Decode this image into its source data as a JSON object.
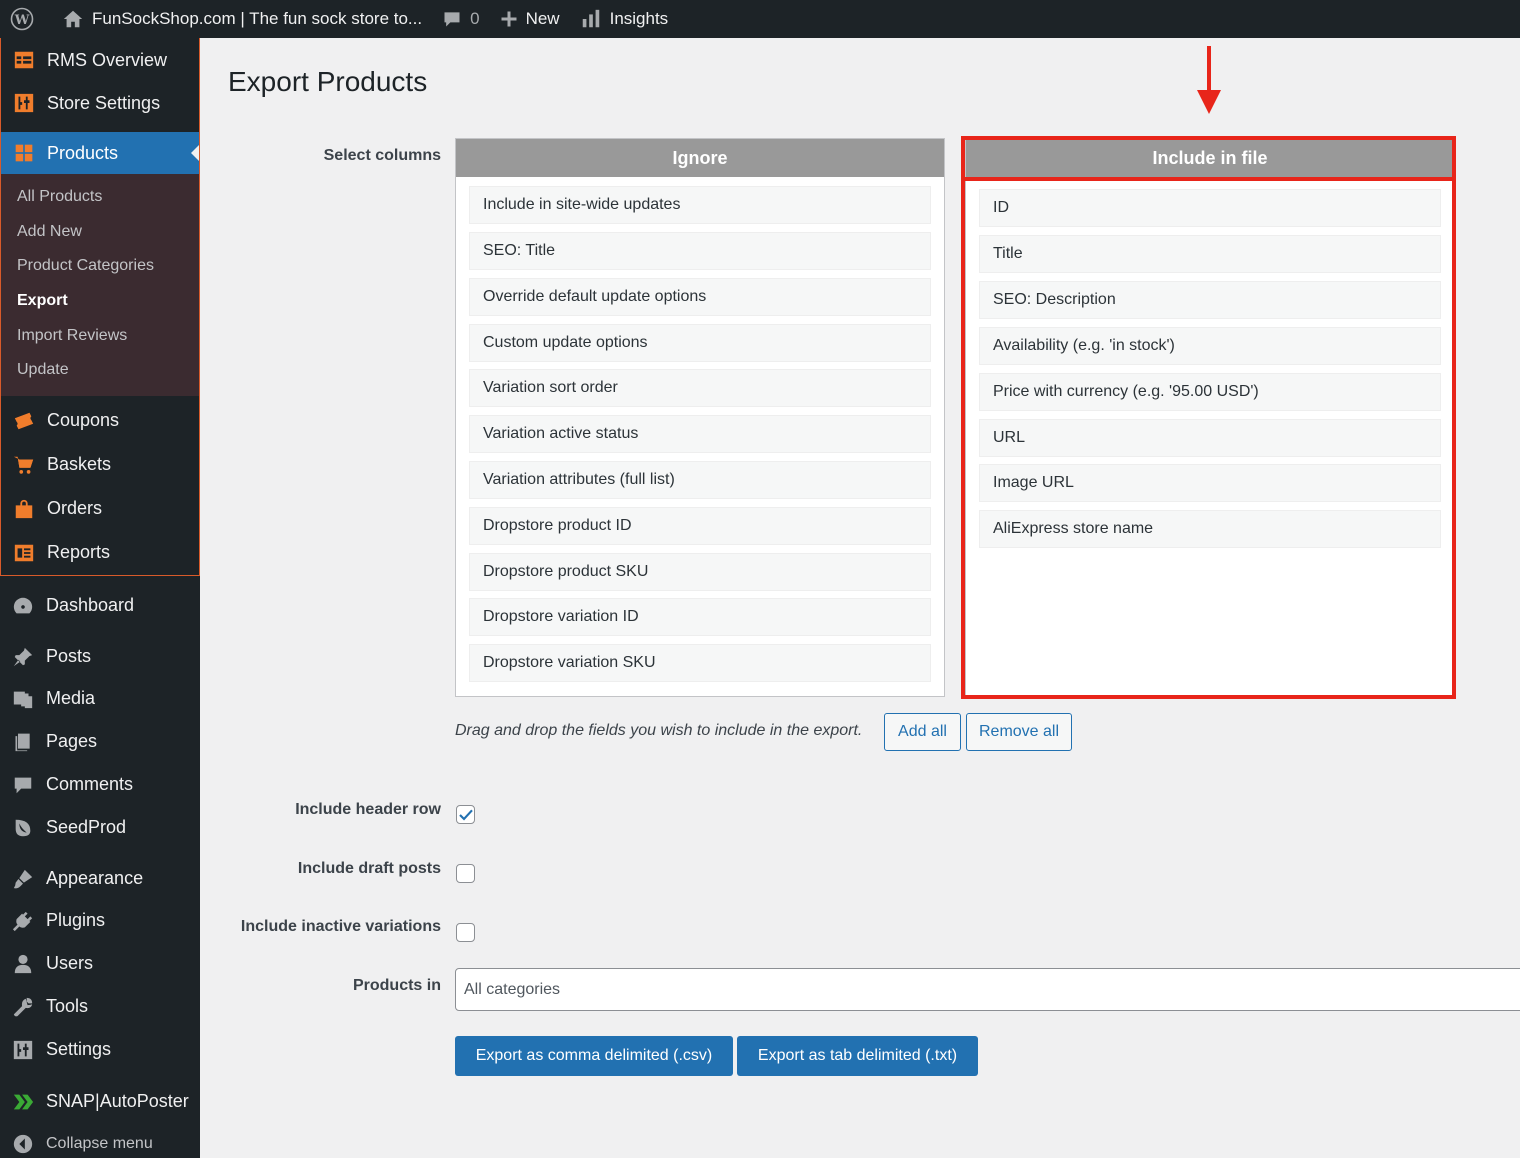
{
  "adminbar": {
    "site_title": "FunSockShop.com | The fun sock store to...",
    "comments_count": "0",
    "new_label": "New",
    "insights_label": "Insights"
  },
  "sidebar": {
    "rms_items": [
      {
        "label": "RMS Overview",
        "icon": "table-icon"
      },
      {
        "label": "Store Settings",
        "icon": "sliders-icon"
      }
    ],
    "products": {
      "label": "Products",
      "submenu": [
        "All Products",
        "Add New",
        "Product Categories",
        "Export",
        "Import Reviews",
        "Update"
      ],
      "current": "Export"
    },
    "rms_items_2": [
      {
        "label": "Coupons",
        "icon": "ticket-icon"
      },
      {
        "label": "Baskets",
        "icon": "cart-icon"
      },
      {
        "label": "Orders",
        "icon": "bag-icon"
      },
      {
        "label": "Reports",
        "icon": "report-icon"
      }
    ],
    "wp_items": [
      {
        "label": "Dashboard",
        "icon": "dashboard-icon"
      },
      {
        "label": "Posts",
        "icon": "pin-icon"
      },
      {
        "label": "Media",
        "icon": "media-icon"
      },
      {
        "label": "Pages",
        "icon": "pages-icon"
      },
      {
        "label": "Comments",
        "icon": "comment-icon"
      },
      {
        "label": "SeedProd",
        "icon": "seed-icon"
      },
      {
        "label": "Appearance",
        "icon": "brush-icon"
      },
      {
        "label": "Plugins",
        "icon": "plug-icon"
      },
      {
        "label": "Users",
        "icon": "user-icon"
      },
      {
        "label": "Tools",
        "icon": "wrench-icon"
      },
      {
        "label": "Settings",
        "icon": "settings-icon"
      },
      {
        "label": "SNAP|AutoPoster",
        "icon": "snap-icon"
      }
    ],
    "collapse_label": "Collapse menu"
  },
  "main": {
    "title": "Export Products",
    "select_columns_label": "Select columns",
    "ignore": {
      "header": "Ignore",
      "items": [
        "Include in site-wide updates",
        "SEO: Title",
        "Override default update options",
        "Custom update options",
        "Variation sort order",
        "Variation active status",
        "Variation attributes (full list)",
        "Dropstore product ID",
        "Dropstore product SKU",
        "Dropstore variation ID",
        "Dropstore variation SKU"
      ]
    },
    "include": {
      "header": "Include in file",
      "items": [
        "ID",
        "Title",
        "SEO: Description",
        "Availability (e.g. 'in stock')",
        "Price with currency (e.g. '95.00 USD')",
        "URL",
        "Image URL",
        "AliExpress store name"
      ]
    },
    "hint": "Drag and drop the fields you wish to include in the export.",
    "add_all": "Add all",
    "remove_all": "Remove all",
    "options": [
      {
        "label": "Include header row",
        "checked": true
      },
      {
        "label": "Include draft posts",
        "checked": false
      },
      {
        "label": "Include inactive variations",
        "checked": false
      }
    ],
    "products_in_label": "Products in",
    "products_in_placeholder": "All categories",
    "export_csv": "Export as comma delimited (.csv)",
    "export_txt": "Export as tab delimited (.txt)"
  },
  "colors": {
    "accent": "#2271b1",
    "highlight": "#e8251a",
    "sidebar_bg": "#1d2327",
    "rms_icon": "#f07d2c"
  }
}
